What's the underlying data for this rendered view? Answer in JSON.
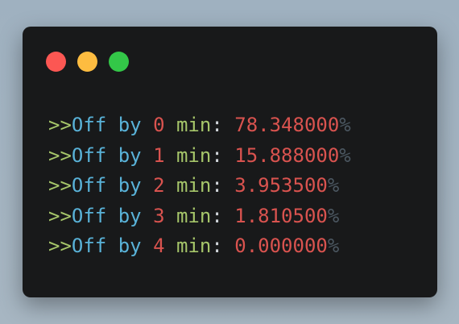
{
  "window": {
    "controls": [
      {
        "name": "close",
        "color": "#fc5753"
      },
      {
        "name": "minimize",
        "color": "#fdbc40"
      },
      {
        "name": "zoom",
        "color": "#33c748"
      }
    ]
  },
  "terminal": {
    "lines": [
      {
        "prompt": ">>",
        "off": "Off",
        "by": "by",
        "n": "0",
        "min": "min",
        "colon": ":",
        "value": "78.348000",
        "pct": "%"
      },
      {
        "prompt": ">>",
        "off": "Off",
        "by": "by",
        "n": "1",
        "min": "min",
        "colon": ":",
        "value": "15.888000",
        "pct": "%"
      },
      {
        "prompt": ">>",
        "off": "Off",
        "by": "by",
        "n": "2",
        "min": "min",
        "colon": ":",
        "value": "3.953500",
        "pct": "%"
      },
      {
        "prompt": ">>",
        "off": "Off",
        "by": "by",
        "n": "3",
        "min": "min",
        "colon": ":",
        "value": "1.810500",
        "pct": "%"
      },
      {
        "prompt": ">>",
        "off": "Off",
        "by": "by",
        "n": "4",
        "min": "min",
        "colon": ":",
        "value": "0.000000",
        "pct": "%"
      }
    ]
  }
}
